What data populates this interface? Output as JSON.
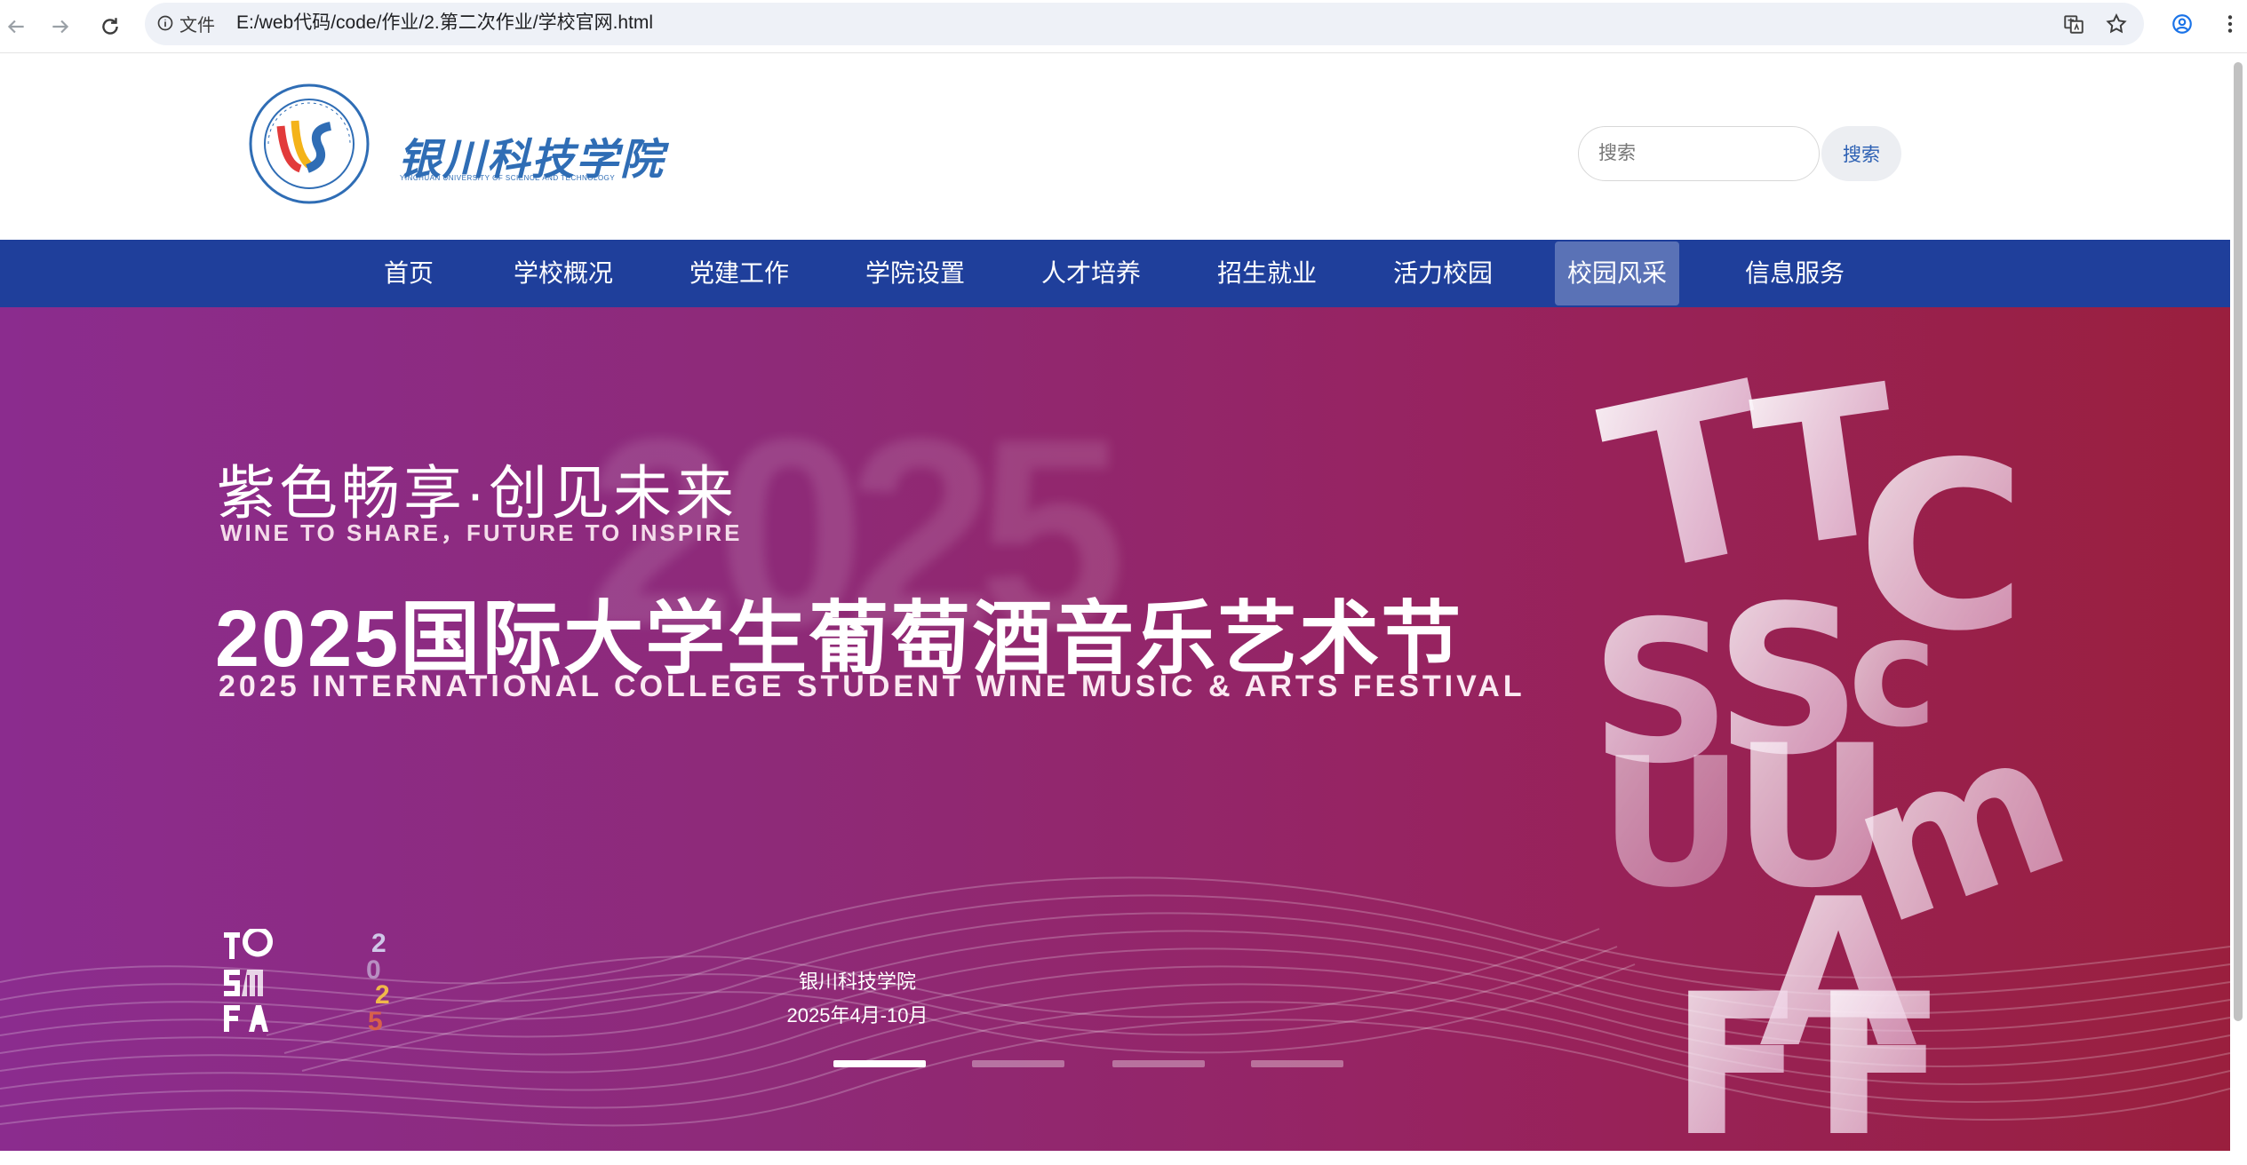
{
  "browser": {
    "info_label": "文件",
    "url": "E:/web代码/code/作业/2.第二次作业/学校官网.html"
  },
  "header": {
    "school_name": "银川科技学院",
    "school_name_en": "YINCHUAN UNIVERSITY OF SCIENCE AND TECHNOLOGY",
    "search_placeholder": "搜索",
    "search_button": "搜索"
  },
  "nav": {
    "items": [
      {
        "label": "首页"
      },
      {
        "label": "学校概况"
      },
      {
        "label": "党建工作"
      },
      {
        "label": "学院设置"
      },
      {
        "label": "人才培养"
      },
      {
        "label": "招生就业"
      },
      {
        "label": "活力校园"
      },
      {
        "label": "校园风采"
      },
      {
        "label": "信息服务"
      }
    ],
    "active_index": 7
  },
  "banner": {
    "slogan_cn": "紫色畅享·创见未来",
    "slogan_en": "WINE TO SHARE，FUTURE TO INSPIRE",
    "title_cn": "2025国际大学生葡萄酒音乐艺术节",
    "title_en": "2025 INTERNATIONAL COLLEGE STUDENT WINE MUSIC & ARTS FESTIVAL",
    "host": "银川科技学院",
    "date": "2025年4月-10月",
    "slide_count": 4,
    "active_slide": 0
  },
  "colors": {
    "nav_bg": "#1f3f9b",
    "nav_active": "#5a72b6",
    "brand_blue": "#2f6db5",
    "banner_left": "#8b2c8e",
    "banner_right": "#9a1f3e"
  }
}
